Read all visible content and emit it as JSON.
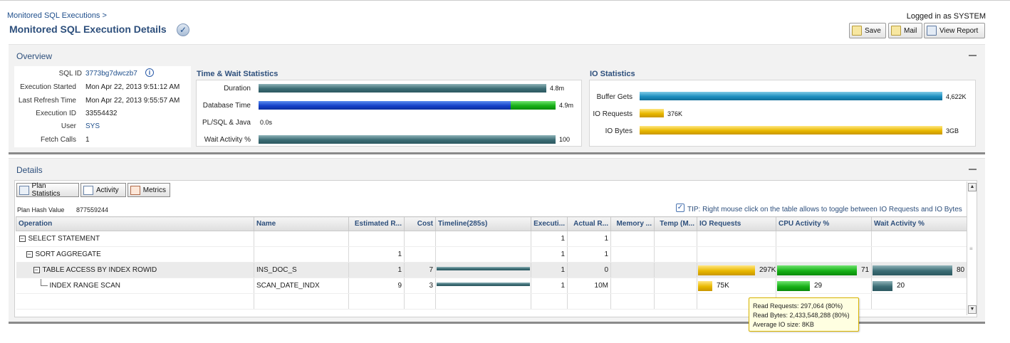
{
  "breadcrumb": "Monitored SQL Executions  >",
  "page_title": "Monitored SQL Execution Details",
  "login_text": "Logged in as SYSTEM",
  "toolbar": {
    "save": "Save",
    "mail": "Mail",
    "view_report": "View Report"
  },
  "overview": {
    "title": "Overview",
    "fields": [
      {
        "label": "SQL ID",
        "value": "3773bg7dwczb7"
      },
      {
        "label": "Execution Started",
        "value": "Mon Apr 22, 2013 9:51:12 AM"
      },
      {
        "label": "Last Refresh Time",
        "value": "Mon Apr 22, 2013 9:55:57 AM"
      },
      {
        "label": "Execution ID",
        "value": "33554432"
      },
      {
        "label": "User",
        "value": "SYS"
      },
      {
        "label": "Fetch Calls",
        "value": "1"
      }
    ],
    "time_wait": {
      "title": "Time & Wait Statistics",
      "rows": [
        {
          "label": "Duration",
          "value": "4.8m",
          "fraction": 0.97
        },
        {
          "label": "Database Time",
          "value": "4.9m",
          "fraction": 1.0,
          "blue_fraction": 0.85
        },
        {
          "label": "PL/SQL & Java",
          "value": "0.0s",
          "fraction": 0
        },
        {
          "label": "Wait Activity %",
          "value": "100",
          "fraction": 1.0
        }
      ]
    },
    "io": {
      "title": "IO Statistics",
      "rows": [
        {
          "label": "Buffer Gets",
          "value": "4,622K",
          "fraction": 1.0
        },
        {
          "label": "IO Requests",
          "value": "376K",
          "fraction": 0.08
        },
        {
          "label": "IO Bytes",
          "value": "3GB",
          "fraction": 1.0
        }
      ]
    }
  },
  "details": {
    "title": "Details",
    "tabs": [
      "Plan Statistics",
      "Activity",
      "Metrics"
    ],
    "plan_hash_label": "Plan Hash Value",
    "plan_hash_value": "877559244",
    "tip": "TIP: Right mouse click on the table allows to toggle between IO Requests and IO Bytes",
    "columns": [
      "Operation",
      "Name",
      "Estimated R...",
      "Cost",
      "Timeline(285s)",
      "Executi...",
      "Actual R...",
      "Memory ...",
      "Temp (M...",
      "IO Requests",
      "CPU Activity %",
      "Wait Activity %"
    ],
    "rows": [
      {
        "operation": "SELECT STATEMENT",
        "name": "",
        "est_rows": "",
        "cost": "",
        "timeline": 0,
        "executions": "1",
        "actual_rows": "1",
        "memory": "",
        "temp": "",
        "io_requests": "",
        "io_fraction": 0,
        "cpu": "",
        "cpu_fraction": 0,
        "wait": "",
        "wait_fraction": 0
      },
      {
        "operation": "SORT AGGREGATE",
        "name": "",
        "est_rows": "1",
        "cost": "",
        "timeline": 0,
        "executions": "1",
        "actual_rows": "1",
        "memory": "",
        "temp": "",
        "io_requests": "",
        "io_fraction": 0,
        "cpu": "",
        "cpu_fraction": 0,
        "wait": "",
        "wait_fraction": 0
      },
      {
        "operation": "TABLE ACCESS BY INDEX ROWID",
        "name": "INS_DOC_S",
        "est_rows": "1",
        "cost": "7",
        "timeline": 1.0,
        "executions": "1",
        "actual_rows": "0",
        "memory": "",
        "temp": "",
        "io_requests": "297K",
        "io_fraction": 0.8,
        "cpu": "71",
        "cpu_fraction": 1.0,
        "wait": "80",
        "wait_fraction": 1.0
      },
      {
        "operation": "INDEX RANGE SCAN",
        "name": "SCAN_DATE_INDX",
        "est_rows": "9",
        "cost": "3",
        "timeline": 1.0,
        "executions": "1",
        "actual_rows": "10M",
        "memory": "",
        "temp": "",
        "io_requests": "75K",
        "io_fraction": 0.2,
        "cpu": "29",
        "cpu_fraction": 0.41,
        "wait": "20",
        "wait_fraction": 0.25
      }
    ],
    "tooltip": [
      "Read Requests: 297,064 (80%)",
      "Read Bytes: 2,433,548,288 (80%)",
      "Average IO size: 8KB"
    ]
  },
  "colors": {
    "title": "#2d4f7c",
    "teal": "#3b6c74",
    "blue": "#1441c9",
    "green": "#17b017",
    "cyan": "#1d8fc0",
    "gold": "#e8b800"
  }
}
